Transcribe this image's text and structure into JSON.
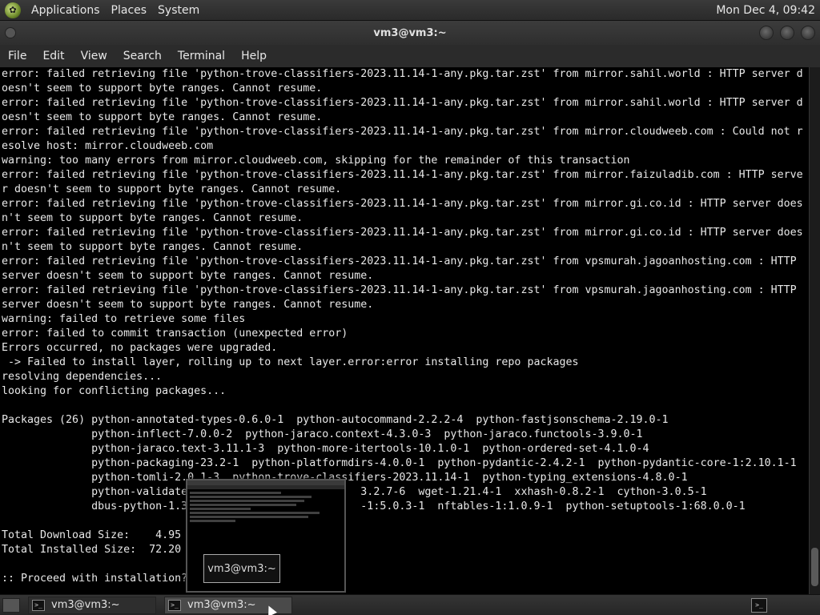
{
  "panel": {
    "menus": [
      "Applications",
      "Places",
      "System"
    ],
    "clock": "Mon Dec 4, 09:42"
  },
  "window": {
    "title": "vm3@vm3:~"
  },
  "menubar": [
    "File",
    "Edit",
    "View",
    "Search",
    "Terminal",
    "Help"
  ],
  "terminal": {
    "lines": [
      "error: failed retrieving file 'python-trove-classifiers-2023.11.14-1-any.pkg.tar.zst' from mirror.sahil.world : HTTP server d",
      "oesn't seem to support byte ranges. Cannot resume.",
      "error: failed retrieving file 'python-trove-classifiers-2023.11.14-1-any.pkg.tar.zst' from mirror.sahil.world : HTTP server d",
      "oesn't seem to support byte ranges. Cannot resume.",
      "error: failed retrieving file 'python-trove-classifiers-2023.11.14-1-any.pkg.tar.zst' from mirror.cloudweeb.com : Could not r",
      "esolve host: mirror.cloudweeb.com",
      "warning: too many errors from mirror.cloudweeb.com, skipping for the remainder of this transaction",
      "error: failed retrieving file 'python-trove-classifiers-2023.11.14-1-any.pkg.tar.zst' from mirror.faizuladib.com : HTTP serve",
      "r doesn't seem to support byte ranges. Cannot resume.",
      "error: failed retrieving file 'python-trove-classifiers-2023.11.14-1-any.pkg.tar.zst' from mirror.gi.co.id : HTTP server does",
      "n't seem to support byte ranges. Cannot resume.",
      "error: failed retrieving file 'python-trove-classifiers-2023.11.14-1-any.pkg.tar.zst' from mirror.gi.co.id : HTTP server does",
      "n't seem to support byte ranges. Cannot resume.",
      "error: failed retrieving file 'python-trove-classifiers-2023.11.14-1-any.pkg.tar.zst' from vpsmurah.jagoanhosting.com : HTTP",
      "server doesn't seem to support byte ranges. Cannot resume.",
      "error: failed retrieving file 'python-trove-classifiers-2023.11.14-1-any.pkg.tar.zst' from vpsmurah.jagoanhosting.com : HTTP",
      "server doesn't seem to support byte ranges. Cannot resume.",
      "warning: failed to retrieve some files",
      "error: failed to commit transaction (unexpected error)",
      "Errors occurred, no packages were upgraded.",
      " -> Failed to install layer, rolling up to next layer.error:error installing repo packages",
      "resolving dependencies...",
      "looking for conflicting packages...",
      "",
      "Packages (26) python-annotated-types-0.6.0-1  python-autocommand-2.2.2-4  python-fastjsonschema-2.19.0-1",
      "              python-inflect-7.0.0-2  python-jaraco.context-4.3.0-3  python-jaraco.functools-3.9.0-1",
      "              python-jaraco.text-3.11.1-3  python-more-itertools-10.1.0-1  python-ordered-set-4.1.0-4",
      "              python-packaging-23.2-1  python-platformdirs-4.0.0-1  python-pydantic-2.4.2-1  python-pydantic-core-1:2.10.1-1",
      "              python-tomli-2.0.1-3  python-trove-classifiers-2023.11.14-1  python-typing_extensions-4.8.0-1",
      "              python-validate                           3.2.7-6  wget-1.21.4-1  xxhash-0.8.2-1  cython-3.0.5-1",
      "              dbus-python-1.3                           -1:5.0.3-1  nftables-1:1.0.9-1  python-setuptools-1:68.0.0-1",
      "",
      "Total Download Size:    4.95",
      "Total Installed Size:  72.20",
      "",
      ":: Proceed with installation?"
    ]
  },
  "preview": {
    "tooltip": "vm3@vm3:~"
  },
  "taskbar": {
    "tasks": [
      {
        "label": "vm3@vm3:~"
      },
      {
        "label": "vm3@vm3:~"
      }
    ]
  }
}
